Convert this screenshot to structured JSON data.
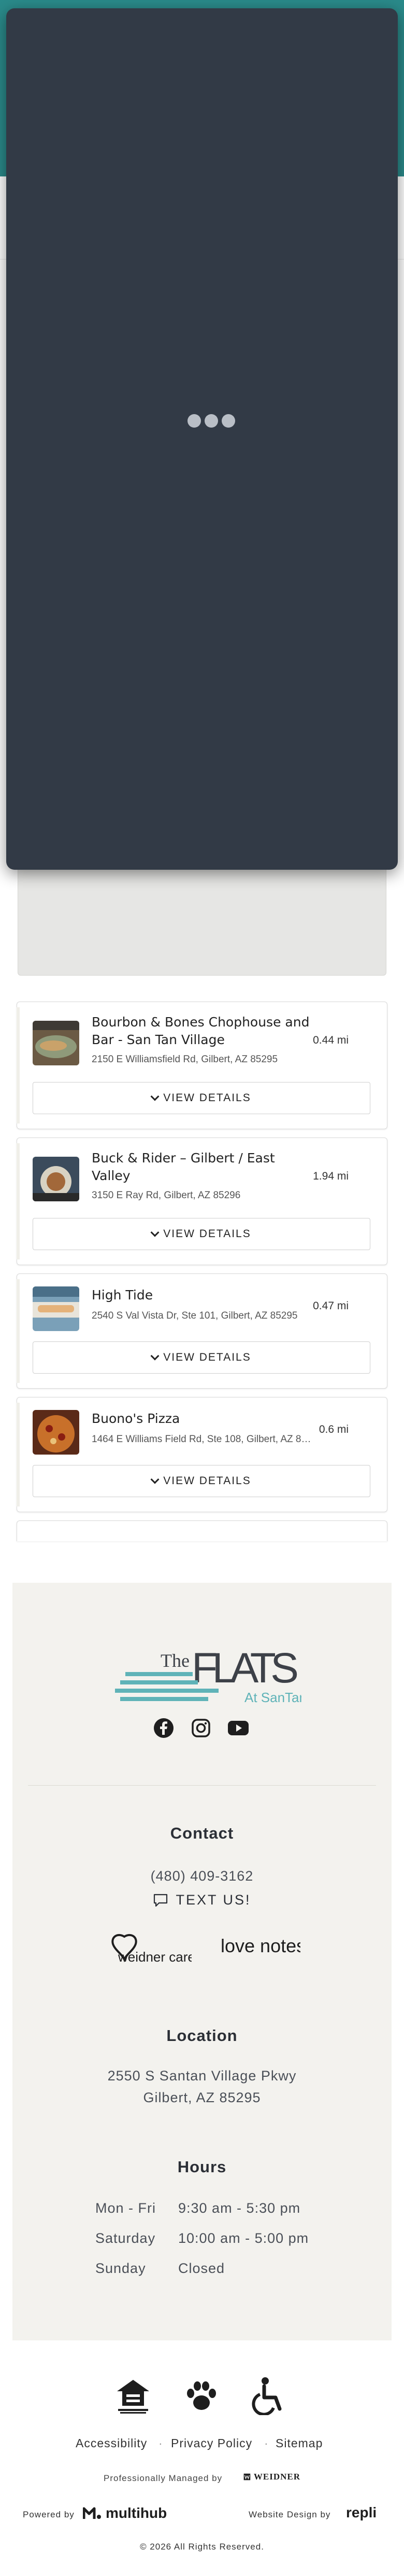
{
  "places": [
    {
      "name": "Bourbon & Bones Chophouse and Bar - San Tan Village",
      "address": "2150 E Williamsfield Rd, Gilbert, AZ 85295",
      "distance": "0.44 mi",
      "button": "VIEW DETAILS"
    },
    {
      "name": "Buck & Rider – Gilbert / East Valley",
      "address": "3150 E Ray Rd, Gilbert, AZ 85296",
      "distance": "1.94 mi",
      "button": "VIEW DETAILS"
    },
    {
      "name": "High Tide",
      "address": "2540 S Val Vista Dr, Ste 101, Gilbert, AZ 85295",
      "distance": "0.47 mi",
      "button": "VIEW DETAILS"
    },
    {
      "name": "Buono's Pizza",
      "address": "1464 E Williams Field Rd, Ste 108, Gilbert, AZ 85295",
      "distance": "0.6 mi",
      "button": "VIEW DETAILS"
    }
  ],
  "logo": {
    "the": "The",
    "flats": "FLATS",
    "at": "At SanTan"
  },
  "contact": {
    "heading": "Contact",
    "phone": "(480) 409-3162",
    "text_us": "TEXT US!"
  },
  "partners": {
    "weidner_cares": "weidner cares",
    "love_notes": "love notes."
  },
  "location": {
    "heading": "Location",
    "line1": "2550 S Santan Village Pkwy",
    "line2": "Gilbert, AZ 85295"
  },
  "hours": {
    "heading": "Hours",
    "rows": [
      {
        "day": "Mon - Fri",
        "time": "9:30 am - 5:30 pm"
      },
      {
        "day": "Saturday",
        "time": "10:00 am - 5:00 pm"
      },
      {
        "day": "Sunday",
        "time": "Closed"
      }
    ]
  },
  "footer_links": {
    "accessibility": "Accessibility",
    "privacy": "Privacy Policy",
    "sitemap": "Sitemap"
  },
  "managed_by": "Professionally Managed by",
  "weidner": "WEIDNER",
  "powered_by": "Powered by",
  "multihub": "multihub",
  "website_design": "Website Design by",
  "repli": "repli",
  "copyright": "© 2026 All Rights Reserved.",
  "colors": {
    "header_teal": "#2a8a8a",
    "modal_dark": "#323a46",
    "footer_bg": "#f3f2ee",
    "logo_teal": "#5fb3b8"
  }
}
